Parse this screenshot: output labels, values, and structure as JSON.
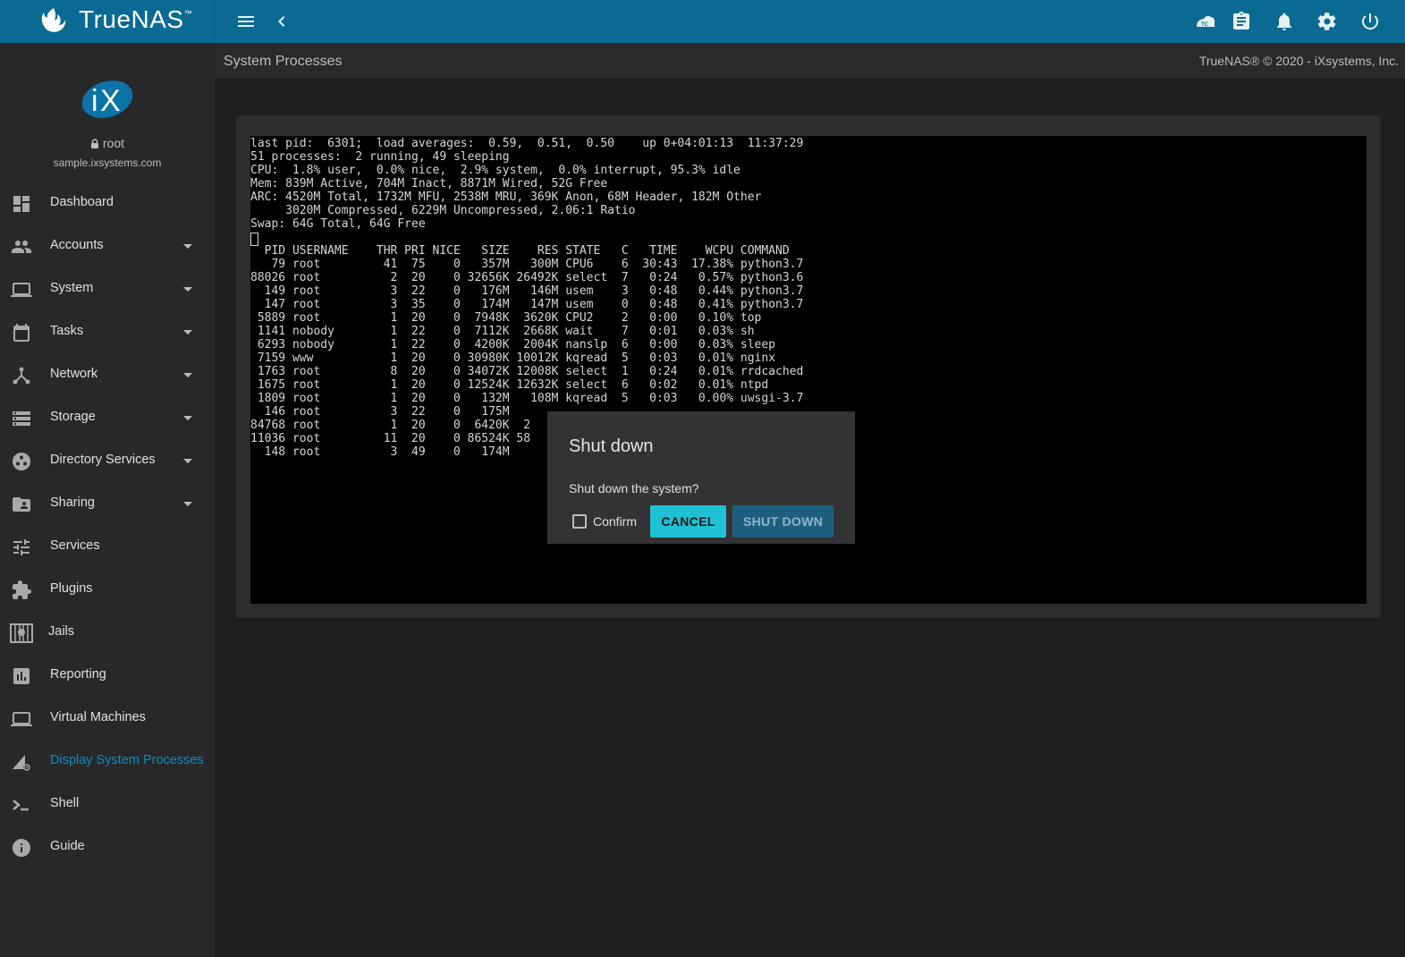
{
  "app": {
    "name": "TrueNAS",
    "trademark": "™"
  },
  "user": {
    "name": "root",
    "host": "sample.ixsystems.com"
  },
  "header": {
    "title": "System Processes",
    "copyright": "TrueNAS® © 2020 - iXsystems, Inc."
  },
  "topbar_icons": [
    "menu-icon",
    "back-chevron-icon",
    "truecommand-icon",
    "clipboard-icon",
    "bell-icon",
    "gear-icon",
    "power-icon"
  ],
  "sidebar": {
    "items": [
      {
        "label": "Dashboard",
        "icon": "dashboard-icon"
      },
      {
        "label": "Accounts",
        "icon": "people-icon"
      },
      {
        "label": "System",
        "icon": "laptop-icon"
      },
      {
        "label": "Tasks",
        "icon": "calendar-icon"
      },
      {
        "label": "Network",
        "icon": "network-icon"
      },
      {
        "label": "Storage",
        "icon": "storage-icon"
      },
      {
        "label": "Directory Services",
        "icon": "directory-icon"
      },
      {
        "label": "Sharing",
        "icon": "folder-shared-icon"
      },
      {
        "label": "Services",
        "icon": "tune-icon"
      },
      {
        "label": "Plugins",
        "icon": "puzzle-icon"
      },
      {
        "label": "Jails",
        "icon": "jail-icon"
      },
      {
        "label": "Reporting",
        "icon": "chart-icon"
      },
      {
        "label": "Virtual Machines",
        "icon": "computer-icon"
      },
      {
        "label": "Display System Processes",
        "icon": "processes-icon"
      },
      {
        "label": "Shell",
        "icon": "terminal-icon"
      },
      {
        "label": "Guide",
        "icon": "info-icon"
      }
    ]
  },
  "terminal": {
    "lines": [
      "last pid:  6301;  load averages:  0.59,  0.51,  0.50    up 0+04:01:13  11:37:29",
      "51 processes:  2 running, 49 sleeping",
      "CPU:  1.8% user,  0.0% nice,  2.9% system,  0.0% interrupt, 95.3% idle",
      "Mem: 839M Active, 704M Inact, 8871M Wired, 52G Free",
      "ARC: 4520M Total, 1732M MFU, 2538M MRU, 369K Anon, 68M Header, 182M Other",
      "     3020M Compressed, 6229M Uncompressed, 2.06:1 Ratio",
      "Swap: 64G Total, 64G Free",
      "",
      "  PID USERNAME    THR PRI NICE   SIZE    RES STATE   C   TIME    WCPU COMMAND",
      "   79 root         41  75    0   357M   300M CPU6    6  30:43  17.38% python3.7",
      "88026 root          2  20    0 32656K 26492K select  7   0:24   0.57% python3.6",
      "  149 root          3  22    0   176M   146M usem    3   0:48   0.44% python3.7",
      "  147 root          3  35    0   174M   147M usem    0   0:48   0.41% python3.7",
      " 5889 root          1  20    0  7948K  3620K CPU2    2   0:00   0.10% top",
      " 1141 nobody        1  22    0  7112K  2668K wait    7   0:01   0.03% sh",
      " 6293 nobody        1  22    0  4200K  2004K nanslp  6   0:00   0.03% sleep",
      " 7159 www           1  20    0 30980K 10012K kqread  5   0:03   0.01% nginx",
      " 1763 root          8  20    0 34072K 12008K select  1   0:24   0.01% rrdcached",
      " 1675 root          1  20    0 12524K 12632K select  6   0:02   0.01% ntpd",
      " 1809 root          1  20    0   132M   108M kqread  5   0:03   0.00% uwsgi-3.7",
      "  146 root          3  22    0   175M",
      "84768 root          1  20    0  6420K  2",
      "11036 root         11  20    0 86524K 58",
      "  148 root          3  49    0   174M"
    ]
  },
  "dialog": {
    "title": "Shut down",
    "message": "Shut down the system?",
    "confirm_label": "Confirm",
    "cancel_label": "CANCEL",
    "shutdown_label": "SHUT DOWN"
  }
}
